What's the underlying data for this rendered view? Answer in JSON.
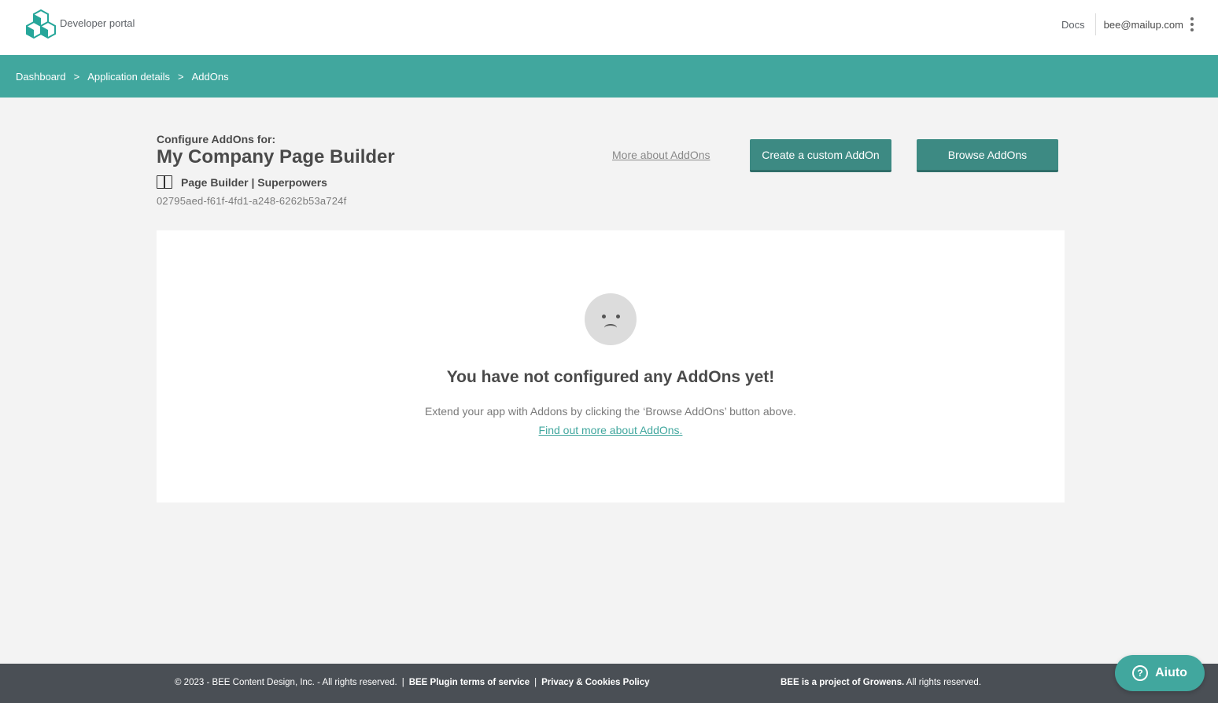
{
  "header": {
    "brand": "Developer portal",
    "docs_label": "Docs",
    "user_email": "bee@mailup.com"
  },
  "breadcrumb": {
    "items": [
      "Dashboard",
      "Application details",
      "AddOns"
    ],
    "separator": ">"
  },
  "app": {
    "configure_label": "Configure AddOns for:",
    "name": "My Company Page Builder",
    "type": "Page Builder | Superpowers",
    "uid": "02795aed-f61f-4fd1-a248-6262b53a724f"
  },
  "actions": {
    "more_link": "More about AddOns",
    "create_button": "Create a custom AddOn",
    "browse_button": "Browse AddOns"
  },
  "empty_state": {
    "title": "You have not configured any AddOns yet!",
    "description": "Extend your app with Addons by clicking the ‘Browse AddOns’ button above.",
    "link": "Find out more about AddOns."
  },
  "footer": {
    "copyright": "© 2023 - BEE Content Design, Inc. - All rights reserved.",
    "terms": "BEE Plugin terms of service",
    "privacy": "Privacy & Cookies Policy",
    "project_strong": "BEE is a project of Growens.",
    "project_rest": "All rights reserved."
  },
  "help": {
    "label": "Aiuto",
    "icon_glyph": "?"
  },
  "colors": {
    "accent": "#41a79e",
    "button": "#3d8a83",
    "footer": "#4a4f55",
    "background": "#f3f3f3"
  }
}
